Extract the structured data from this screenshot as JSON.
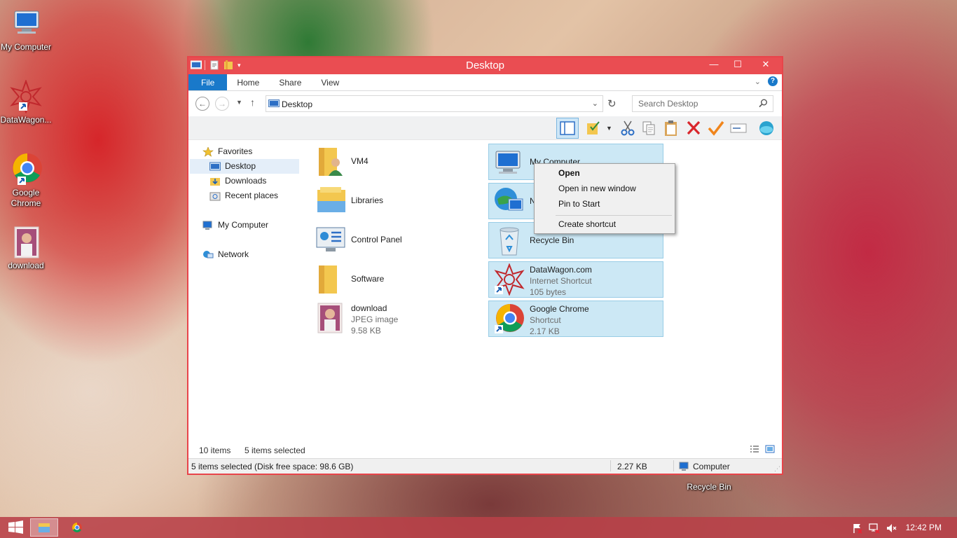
{
  "desktop_icons": [
    {
      "label": "My Computer",
      "icon": "computer-icon"
    },
    {
      "label": "DataWagon...",
      "icon": "datawagon-shortcut-icon"
    },
    {
      "label": "Google Chrome",
      "icon": "chrome-shortcut-icon"
    },
    {
      "label": "download",
      "icon": "jpeg-image-icon"
    }
  ],
  "desktop_recycle_label": "Recycle Bin",
  "window": {
    "title": "Desktop",
    "controls": {
      "minimize": "—",
      "maximize": "☐",
      "close": "✕"
    }
  },
  "ribbon": {
    "tabs": [
      "File",
      "Home",
      "Share",
      "View"
    ]
  },
  "address": {
    "path": "Desktop",
    "search_placeholder": "Search Desktop"
  },
  "navigation": {
    "favorites_label": "Favorites",
    "items": [
      "Desktop",
      "Downloads",
      "Recent places"
    ],
    "computer_label": "My Computer",
    "network_label": "Network"
  },
  "files": {
    "left": [
      {
        "name": "VM4",
        "sub1": "",
        "sub2": "",
        "icon": "user-folder-icon"
      },
      {
        "name": "Libraries",
        "sub1": "",
        "sub2": "",
        "icon": "libraries-icon"
      },
      {
        "name": "Control Panel",
        "sub1": "",
        "sub2": "",
        "icon": "control-panel-icon"
      },
      {
        "name": "Software",
        "sub1": "",
        "sub2": "",
        "icon": "folder-icon"
      },
      {
        "name": "download",
        "sub1": "JPEG image",
        "sub2": "9.58 KB",
        "icon": "jpeg-image-icon"
      }
    ],
    "right": [
      {
        "name": "My Computer",
        "sub1": "",
        "sub2": "",
        "icon": "computer-icon"
      },
      {
        "name": "N",
        "sub1": "",
        "sub2": "",
        "icon": "network-icon"
      },
      {
        "name": "Recycle Bin",
        "sub1": "",
        "sub2": "",
        "icon": "recycle-bin-icon"
      },
      {
        "name": "DataWagon.com",
        "sub1": "Internet Shortcut",
        "sub2": "105 bytes",
        "icon": "datawagon-shortcut-icon"
      },
      {
        "name": "Google Chrome",
        "sub1": "Shortcut",
        "sub2": "2.17 KB",
        "icon": "chrome-shortcut-icon"
      }
    ]
  },
  "context_menu": {
    "items": [
      "Open",
      "Open in new window",
      "Pin to Start",
      "Create shortcut"
    ]
  },
  "status": {
    "item_count": "10 items",
    "selected_count": "5 items selected",
    "detail": "5 items selected (Disk free space: 98.6 GB)",
    "size": "2.27 KB",
    "location": "Computer"
  },
  "taskbar": {
    "time": "12:42 PM"
  },
  "colors": {
    "accent": "#ea4d52",
    "file_tab": "#1979ca",
    "selection": "#cce8f5"
  }
}
